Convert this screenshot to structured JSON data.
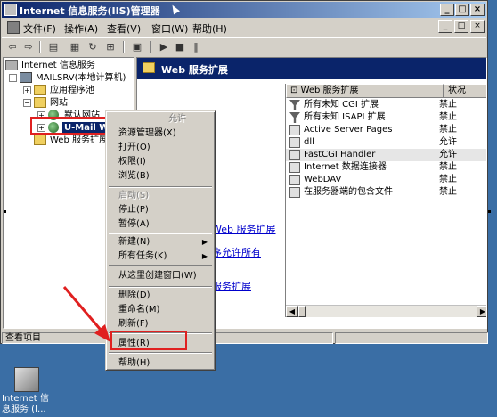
{
  "window": {
    "title": "Internet 信息服务(IIS)管理器",
    "buttons": {
      "minimize": "_",
      "maximize": "□",
      "close": "×"
    }
  },
  "menubar": {
    "items": [
      "文件(F)",
      "操作(A)",
      "查看(V)",
      "窗口(W)",
      "帮助(H)"
    ],
    "mdi_buttons": [
      "_",
      "□",
      "×"
    ]
  },
  "toolbar": {
    "buttons": [
      "back",
      "forward",
      "up",
      "properties",
      "refresh",
      "export",
      "help",
      "start",
      "stop",
      "pause"
    ]
  },
  "tree": {
    "root": "Internet 信息服务",
    "server": "MAILSRV(本地计算机)",
    "app_pool": "应用程序池",
    "websites": "网站",
    "default_site": "默认网站",
    "selected_site": "U-Mail WebMail",
    "web_ext": "Web 服务扩展"
  },
  "right_pane": {
    "header": "Web 服务扩展",
    "links": [
      "Web 服务扩展",
      "序允许所有",
      "服务扩展"
    ],
    "columns": [
      "Web 服务扩展",
      "状况"
    ],
    "rows": [
      {
        "icon": "filter-icon",
        "name": "所有未知 CGI 扩展",
        "status": "禁止"
      },
      {
        "icon": "filter-icon",
        "name": "所有未知 ISAPI 扩展",
        "status": "禁止"
      },
      {
        "icon": "extension-icon",
        "name": "Active Server Pages",
        "status": "禁止"
      },
      {
        "icon": "extension-icon",
        "name": "dll",
        "status": "允许"
      },
      {
        "icon": "extension-icon",
        "name": "FastCGI Handler",
        "status": "允许"
      },
      {
        "icon": "extension-icon",
        "name": "Internet 数据连接器",
        "status": "禁止"
      },
      {
        "icon": "extension-icon",
        "name": "WebDAV",
        "status": "禁止"
      },
      {
        "icon": "extension-icon",
        "name": "在服务器端的包含文件",
        "status": "禁止"
      }
    ]
  },
  "statusbar": {
    "text": "查看项目"
  },
  "context_menu": {
    "header": "允许",
    "items": [
      {
        "label": "资源管理器(X)",
        "disabled": false
      },
      {
        "label": "打开(O)",
        "disabled": false
      },
      {
        "label": "权限(I)",
        "disabled": false
      },
      {
        "label": "浏览(B)",
        "disabled": false
      },
      {
        "label": "启动(S)",
        "disabled": true
      },
      {
        "label": "停止(P)",
        "disabled": false
      },
      {
        "label": "暂停(A)",
        "disabled": false
      },
      {
        "label": "新建(N)",
        "disabled": false,
        "submenu": true
      },
      {
        "label": "所有任务(K)",
        "disabled": false,
        "submenu": true
      },
      {
        "label": "从这里创建窗口(W)",
        "disabled": false
      },
      {
        "label": "删除(D)",
        "disabled": false
      },
      {
        "label": "重命名(M)",
        "disabled": false
      },
      {
        "label": "刷新(F)",
        "disabled": false
      },
      {
        "label": "属性(R)",
        "disabled": false
      },
      {
        "label": "帮助(H)",
        "disabled": false
      }
    ],
    "arrow_glyph": "▶"
  },
  "desktop": {
    "icon_label": "Internet 信息服务 (I..."
  },
  "colors": {
    "titlebar_start": "#0a246a",
    "titlebar_end": "#a6caf0",
    "highlight_box": "#e02020",
    "desktop": "#3a6ea5"
  }
}
